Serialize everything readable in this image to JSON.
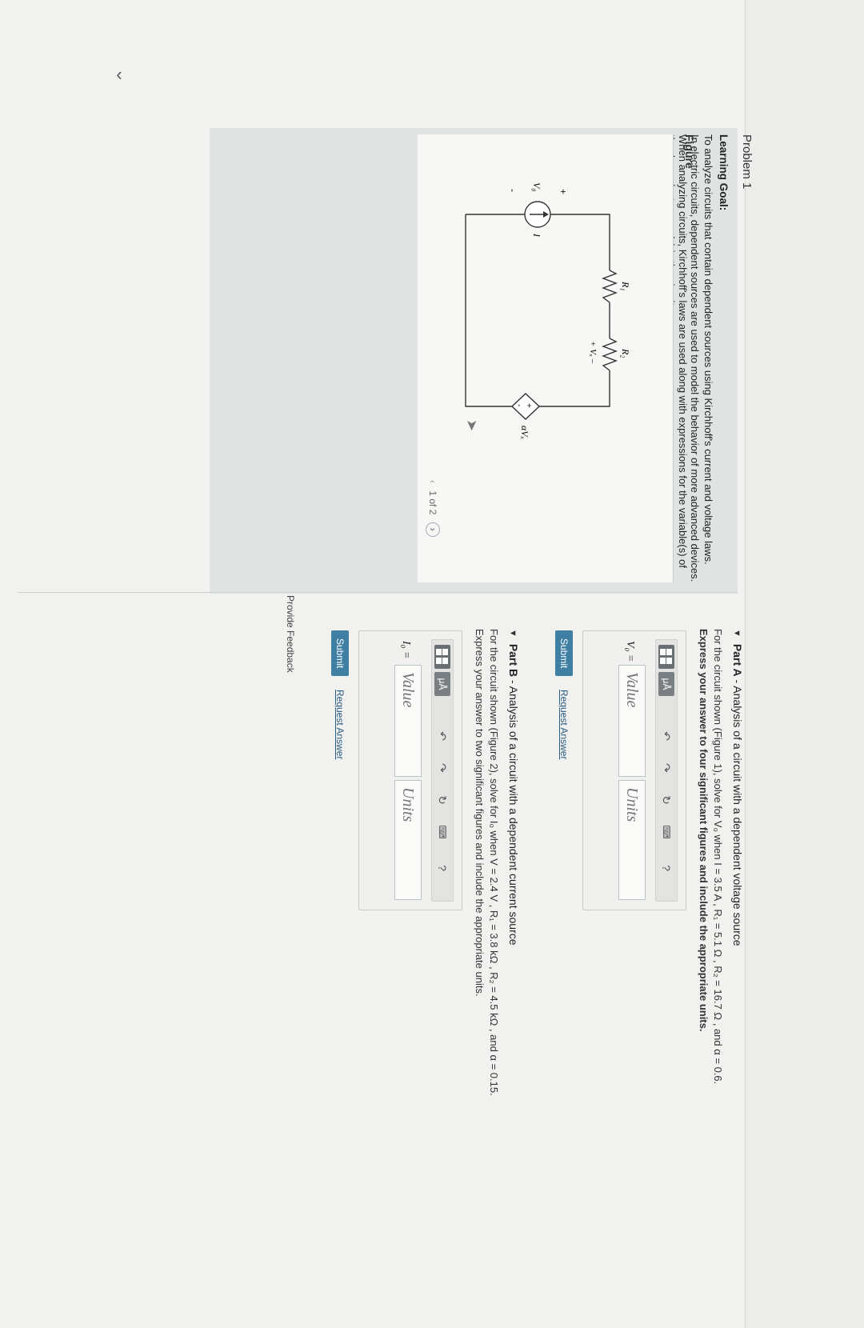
{
  "problem": {
    "title": "Problem 1"
  },
  "learning_goal": {
    "label": "Learning Goal:",
    "paragraphs": [
      "To analyze circuits that contain dependent sources using Kirchhoff's current and voltage laws.",
      "In electric circuits, dependent sources are used to model the behavior of more advanced devices. When analyzing circuits, Kirchhoff's laws are used along with expressions for the variable(s) of the dependent source(s) in the circuit."
    ]
  },
  "figure": {
    "title": "Figure",
    "pager": {
      "text": "1 of 2"
    },
    "labels": {
      "r1": "R₁",
      "r2": "R₂",
      "v0": "V₀",
      "i": "I",
      "vx": "+ Vₓ –",
      "plus": "+",
      "minus": "-",
      "dep": "αVₓ"
    }
  },
  "part_a": {
    "prefix": "Part A",
    "title": " - Analysis of a circuit with a dependent voltage source",
    "description": "For the circuit shown (Figure 1), solve for V₀ when I = 3.5 A , R₁ = 5.1 Ω , R₂ = 16.7 Ω , and α = 0.6.",
    "instruction": "Express your answer to four significant figures and include the appropriate units.",
    "variable": "V₀ =",
    "value_placeholder": "Value",
    "units_placeholder": "Units",
    "submit": "Submit",
    "request_answer": "Request Answer"
  },
  "part_b": {
    "prefix": "Part B",
    "title": " - Analysis of a circuit with a dependent current source",
    "description": "For the circuit shown (Figure 2), solve for I₀ when V = 2.4 V , R₁ = 3.8 kΩ , R₂ = 4.5 kΩ , and α = 0.15.",
    "instruction": "Express your answer to two significant figures and include the appropriate units.",
    "variable": "I₀ =",
    "value_placeholder": "Value",
    "units_placeholder": "Units",
    "submit": "Submit",
    "request_answer": "Request Answer"
  },
  "toolbar": {
    "mu": "μÅ",
    "undo": "↶",
    "redo": "↷",
    "reset": "↻",
    "keyboard": "⌨",
    "help": "?"
  },
  "feedback": "Provide Feedback",
  "colors": {
    "accent": "#3f7fa4",
    "goal_bg": "#dfe4e2",
    "link": "#2a5d82"
  }
}
